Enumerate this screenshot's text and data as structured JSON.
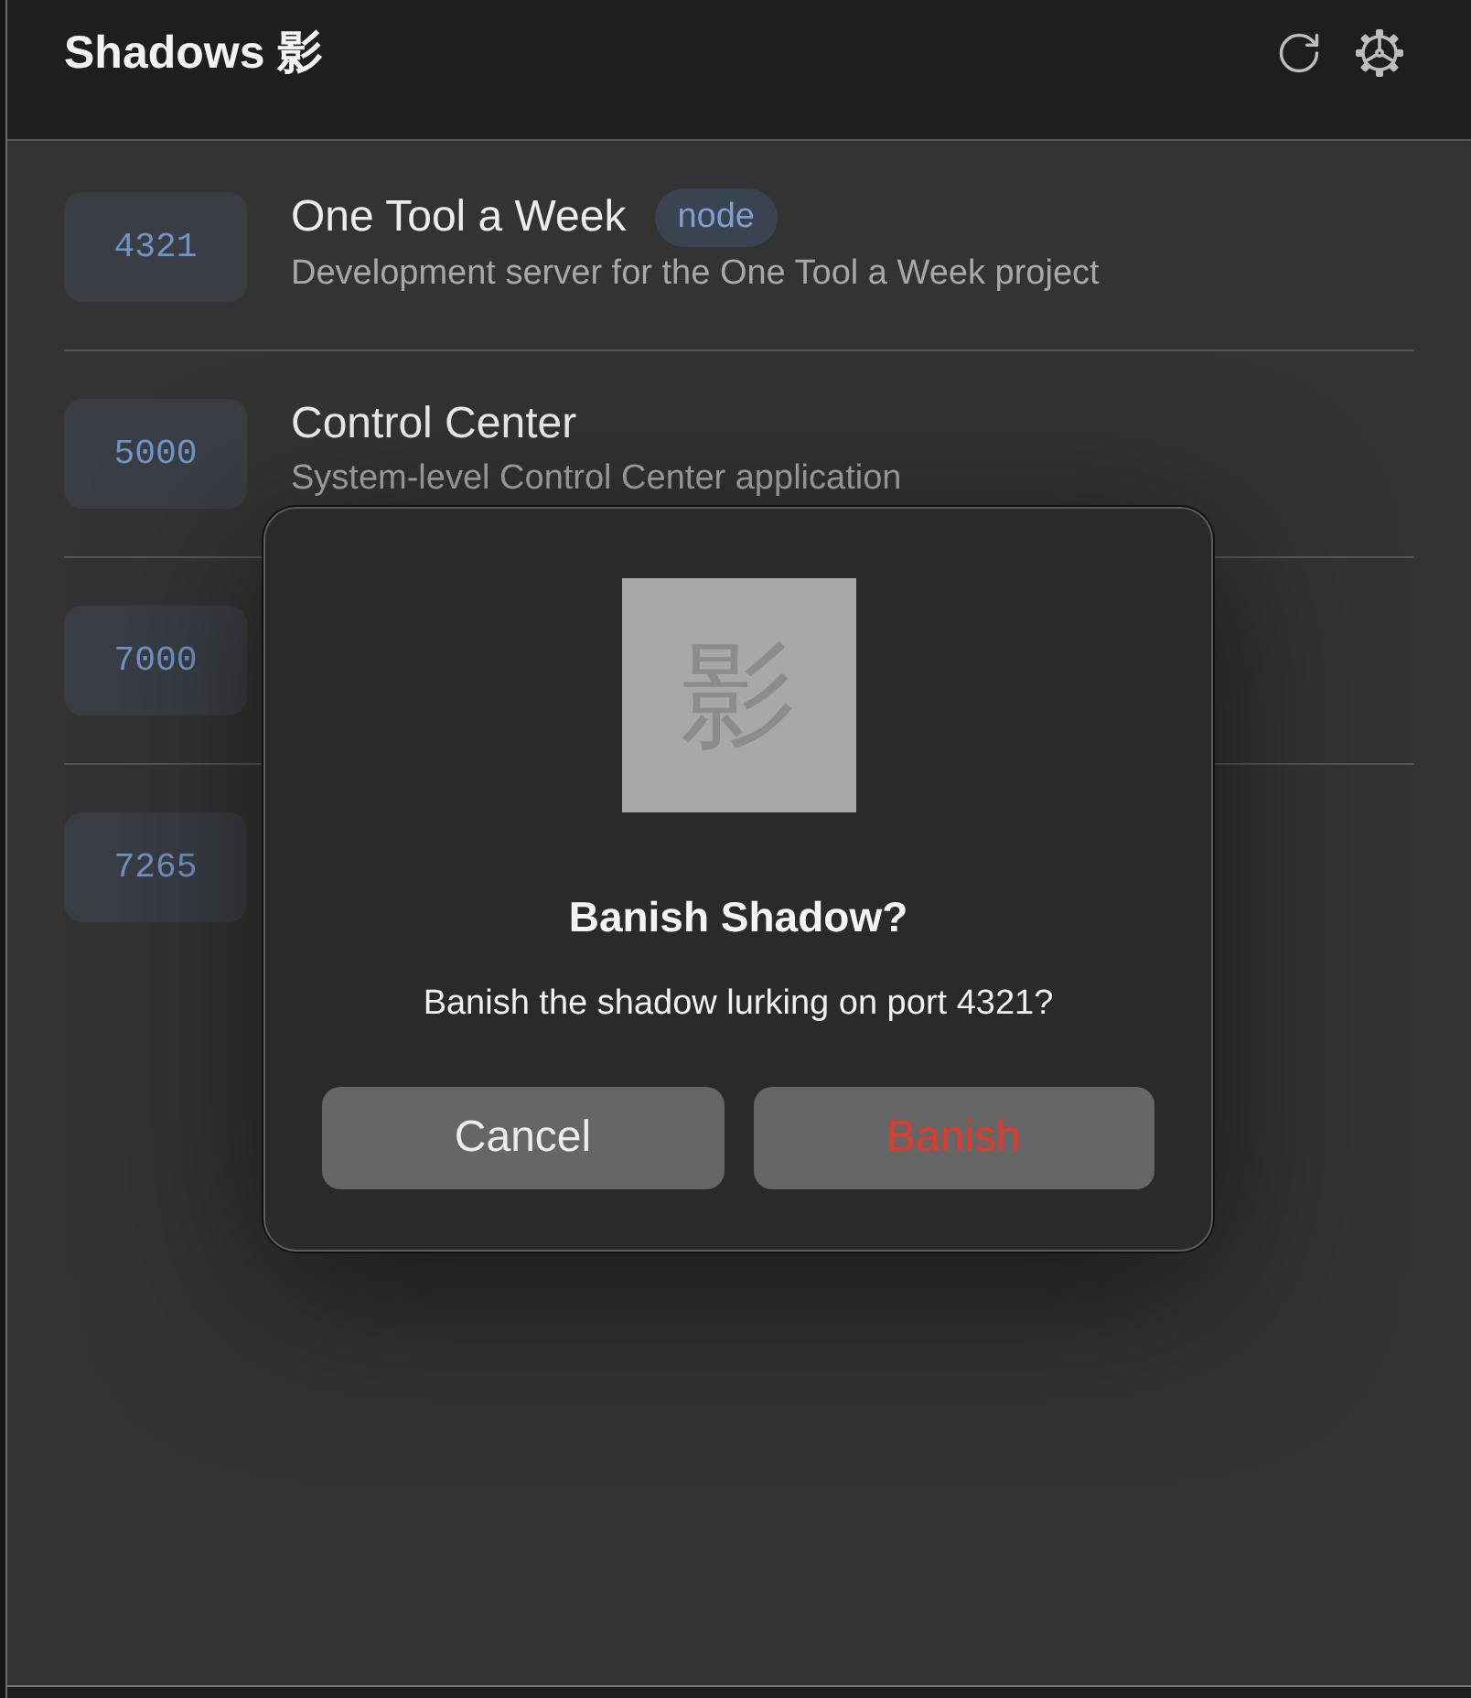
{
  "window": {
    "title": "Shadows 影"
  },
  "shadows": [
    {
      "port": "4321",
      "name": "One Tool a Week",
      "tag": "node",
      "description": "Development server for the One Tool a Week project"
    },
    {
      "port": "5000",
      "name": "Control Center",
      "description": "System-level Control Center application"
    },
    {
      "port": "7000"
    },
    {
      "port": "7265"
    }
  ],
  "dialog": {
    "logo_glyph": "影",
    "title": "Banish Shadow?",
    "message": "Banish the shadow lurking on port 4321?",
    "buttons": [
      {
        "label": "Cancel",
        "kind": "cancel"
      },
      {
        "label": "Banish",
        "kind": "destructive"
      }
    ]
  }
}
